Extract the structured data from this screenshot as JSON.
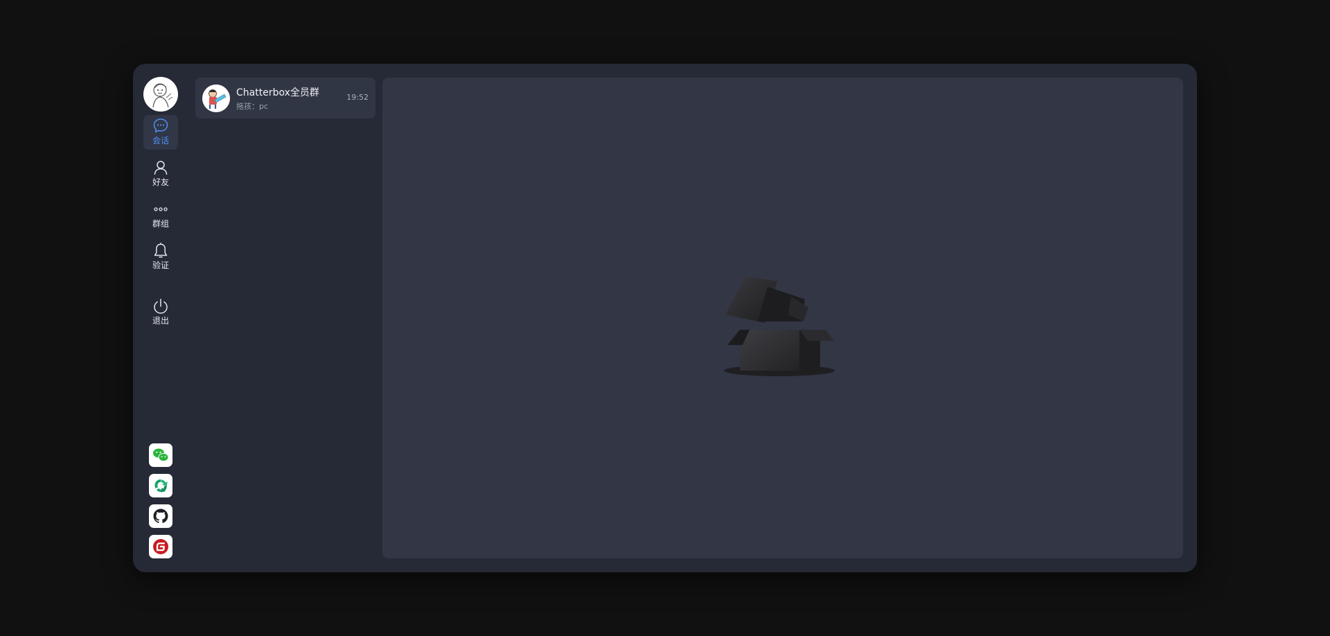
{
  "nav": {
    "items": [
      {
        "id": "chat",
        "label": "会话",
        "icon": "chat-bubble-icon",
        "active": true
      },
      {
        "id": "friends",
        "label": "好友",
        "icon": "person-icon",
        "active": false
      },
      {
        "id": "groups",
        "label": "群组",
        "icon": "three-dots-icon",
        "active": false
      },
      {
        "id": "verify",
        "label": "验证",
        "icon": "bell-icon",
        "active": false
      },
      {
        "id": "logout",
        "label": "退出",
        "icon": "power-icon",
        "active": false
      }
    ],
    "external_links": [
      {
        "icon": "wechat-icon"
      },
      {
        "icon": "recycle-logo-icon"
      },
      {
        "icon": "github-icon"
      },
      {
        "icon": "gitee-icon"
      }
    ]
  },
  "conversations": [
    {
      "name": "Chatterbox全员群",
      "last_message": "拖孩：pc",
      "time": "19:52"
    }
  ],
  "colors": {
    "accent": "#4f8ff0",
    "app_bg": "#262a36",
    "panel_bg": "#323645",
    "page_bg": "#111111"
  }
}
